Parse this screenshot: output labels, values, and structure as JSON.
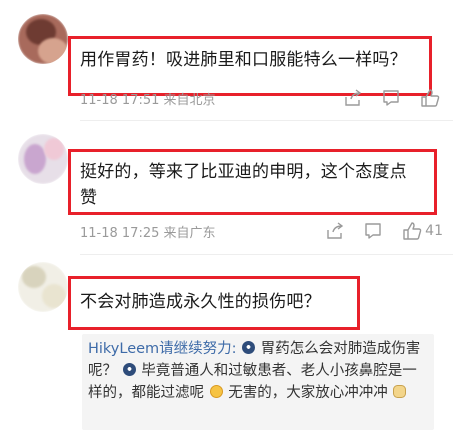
{
  "colors": {
    "highlight_border": "#e8202a",
    "meta_text": "#9a9a9a",
    "reply_username": "#3e6ba8",
    "reply_background": "#f4f4f4"
  },
  "comments": [
    {
      "text": "用作胃药！吸进肺里和口服能特么一样吗？",
      "time_location": "11-18 17:51 来自北京",
      "actions": [
        "share-icon",
        "comment-icon",
        "like-icon"
      ],
      "likes": ""
    },
    {
      "text_line1": "挺好的，等来了比亚迪的申明，这个态度点",
      "text_line2": "赞",
      "time_location": "11-18 17:25 来自广东",
      "actions": [
        "share-icon",
        "comment-icon",
        "like-icon"
      ],
      "likes": "41"
    },
    {
      "text": "不会对肺造成永久性的损伤吧？",
      "reply": {
        "username": "HikyLeem请继续努力:",
        "part1": "胃药怎么会对肺造成伤害呢？",
        "part2": "毕竟普通人和过敏患者、老人小孩鼻腔是一样的，都能过滤呢",
        "part3": "无害的，大家放心冲冲冲",
        "emoji_names": [
          "mask-emoji",
          "mask-emoji",
          "smile-emoji",
          "cat-emoji"
        ]
      }
    }
  ]
}
